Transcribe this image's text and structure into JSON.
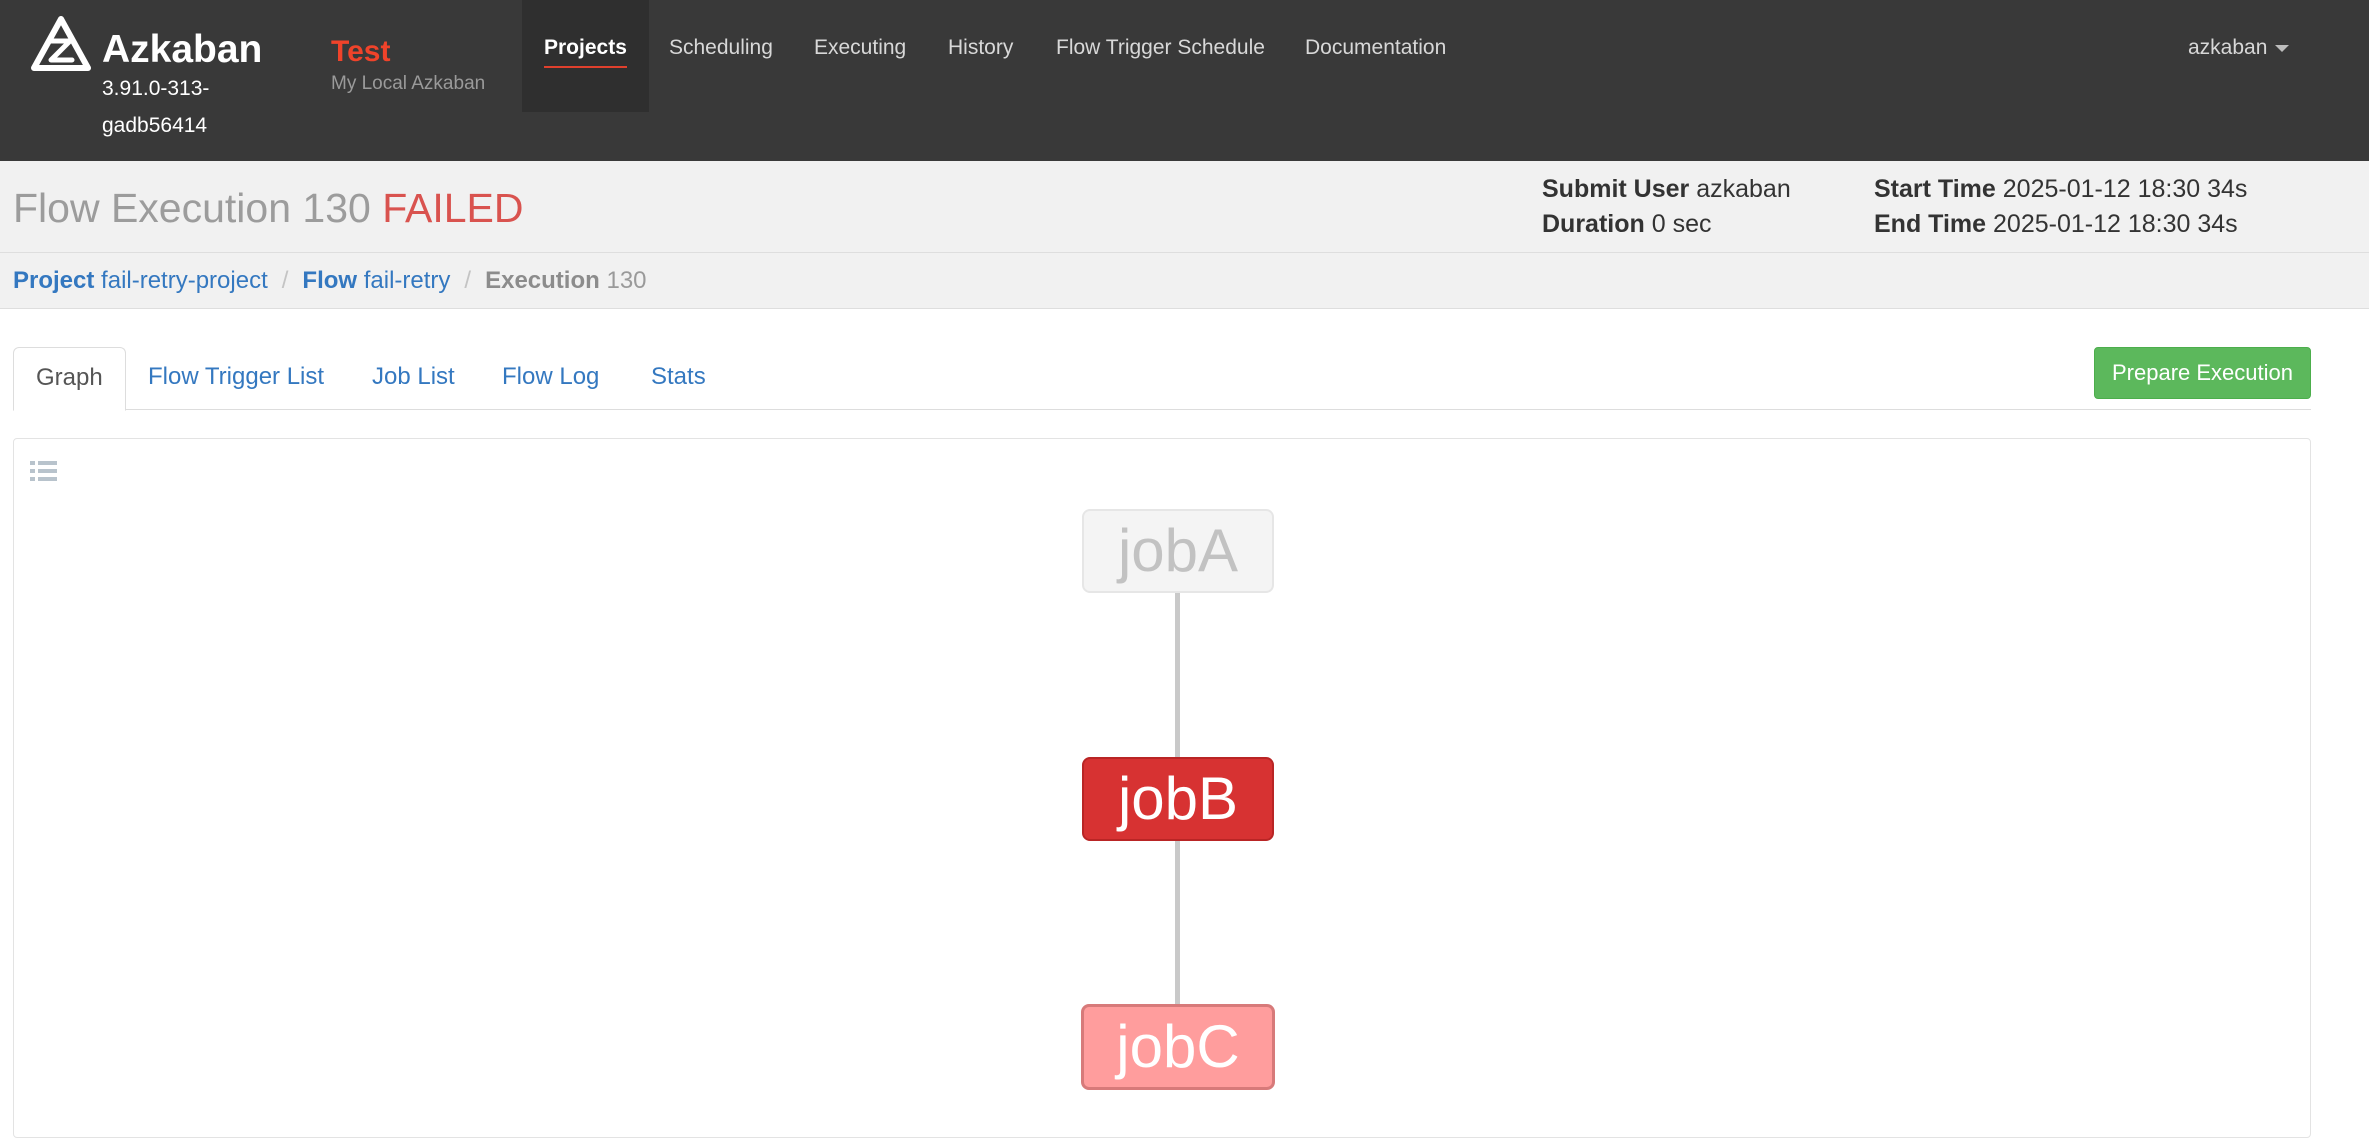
{
  "brand": {
    "name": "Azkaban",
    "version": "3.91.0-313-gadb56414"
  },
  "env": {
    "name": "Test",
    "description": "My Local Azkaban"
  },
  "nav": {
    "items": [
      "Projects",
      "Scheduling",
      "Executing",
      "History",
      "Flow Trigger Schedule",
      "Documentation"
    ],
    "active": "Projects"
  },
  "user": {
    "name": "azkaban"
  },
  "execution": {
    "title": "Flow Execution 130",
    "status": "FAILED",
    "submit_user_label": "Submit User",
    "submit_user": "azkaban",
    "duration_label": "Duration",
    "duration": "0 sec",
    "start_time_label": "Start Time",
    "start_time": "2025-01-12 18:30 34s",
    "end_time_label": "End Time",
    "end_time": "2025-01-12 18:30 34s"
  },
  "breadcrumb": {
    "project_label": "Project",
    "project": "fail-retry-project",
    "flow_label": "Flow",
    "flow": "fail-retry",
    "execution_label": "Execution",
    "execution": "130",
    "separator": "/"
  },
  "tabs": [
    "Graph",
    "Flow Trigger List",
    "Job List",
    "Flow Log",
    "Stats"
  ],
  "actions": {
    "prepare_execution": "Prepare Execution"
  },
  "graph": {
    "nodes": [
      {
        "id": "jobA",
        "label": "jobA",
        "status": "ready"
      },
      {
        "id": "jobB",
        "label": "jobB",
        "status": "failed"
      },
      {
        "id": "jobC",
        "label": "jobC",
        "status": "killed"
      }
    ],
    "edges": [
      [
        "jobA",
        "jobB"
      ],
      [
        "jobB",
        "jobC"
      ]
    ]
  },
  "colors": {
    "navbar": "#393939",
    "failed": "#d9534f",
    "link": "#3478c0",
    "success_button": "#5cb85c",
    "env": "#f0432a"
  }
}
